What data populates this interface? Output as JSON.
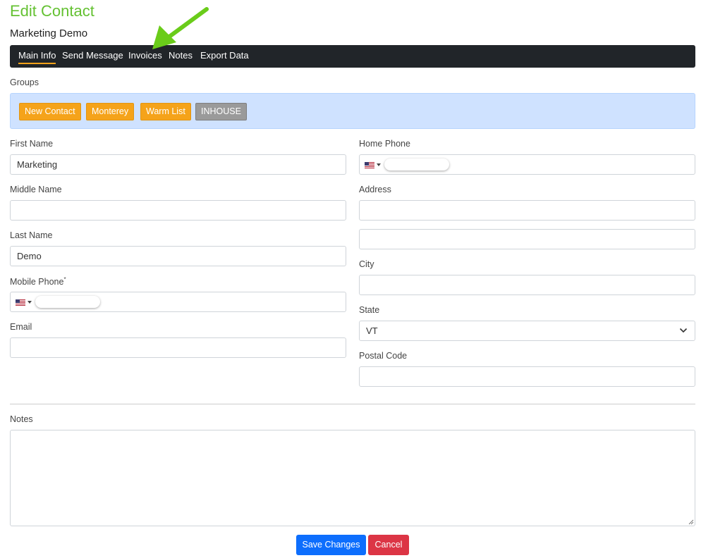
{
  "page": {
    "title": "Edit Contact",
    "contact_name": "Marketing Demo"
  },
  "tabs": [
    {
      "label": "Main Info",
      "active": true
    },
    {
      "label": "Send Message",
      "active": false
    },
    {
      "label": "Invoices",
      "active": false
    },
    {
      "label": "Notes",
      "active": false
    },
    {
      "label": "Export Data",
      "active": false
    }
  ],
  "groups": {
    "label": "Groups",
    "items": [
      {
        "label": "New Contact",
        "color": "#f5a31a"
      },
      {
        "label": "Monterey",
        "color": "#f5a31a"
      },
      {
        "label": "Warm List",
        "color": "#f5a31a"
      },
      {
        "label": "INHOUSE",
        "color": "#9a9a9a"
      }
    ]
  },
  "form": {
    "first_name": {
      "label": "First Name",
      "value": "Marketing"
    },
    "middle_name": {
      "label": "Middle Name",
      "value": ""
    },
    "last_name": {
      "label": "Last Name",
      "value": "Demo"
    },
    "mobile_phone": {
      "label": "Mobile Phone",
      "required_mark": "*",
      "country": "us-flag-icon",
      "value": ""
    },
    "email": {
      "label": "Email",
      "value": ""
    },
    "home_phone": {
      "label": "Home Phone",
      "country": "us-flag-icon",
      "value": ""
    },
    "address": {
      "label": "Address",
      "line1": "",
      "line2": ""
    },
    "city": {
      "label": "City",
      "value": ""
    },
    "state": {
      "label": "State",
      "value": "VT"
    },
    "postal_code": {
      "label": "Postal Code",
      "value": ""
    },
    "notes": {
      "label": "Notes",
      "value": ""
    }
  },
  "actions": {
    "save_label": "Save Changes",
    "cancel_label": "Cancel"
  },
  "colors": {
    "title": "#64c132",
    "tab_bar": "#212529",
    "tab_active_underline": "#f5a31a",
    "groups_bg": "#cfe2ff",
    "save": "#0d6efd",
    "cancel": "#dc3545",
    "annotation_arrow": "#6acc1a"
  }
}
